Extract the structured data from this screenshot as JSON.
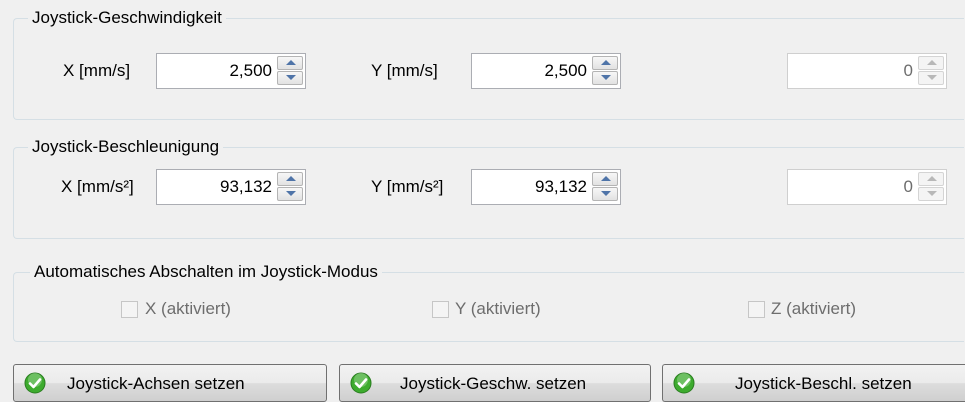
{
  "speed": {
    "title": "Joystick-Geschwindigkeit",
    "x_label": "X [mm/s]",
    "x_value": "2,500",
    "y_label": "Y [mm/s]",
    "y_value": "2,500",
    "z_value": "0"
  },
  "accel": {
    "title": "Joystick-Beschleunigung",
    "x_label": "X [mm/s²]",
    "x_value": "93,132",
    "y_label": "Y [mm/s²]",
    "y_value": "93,132",
    "z_value": "0"
  },
  "auto_off": {
    "title": "Automatisches Abschalten im Joystick-Modus",
    "x_label": "X (aktiviert)",
    "y_label": "Y (aktiviert)",
    "z_label": "Z (aktiviert)",
    "x_checked": false,
    "y_checked": false,
    "z_checked": false
  },
  "buttons": {
    "axes_label": "Joystick-Achsen setzen",
    "speed_label": "Joystick-Geschw. setzen",
    "accel_label": "Joystick-Beschl. setzen"
  },
  "colors": {
    "ok_icon": "#3dab2e"
  }
}
